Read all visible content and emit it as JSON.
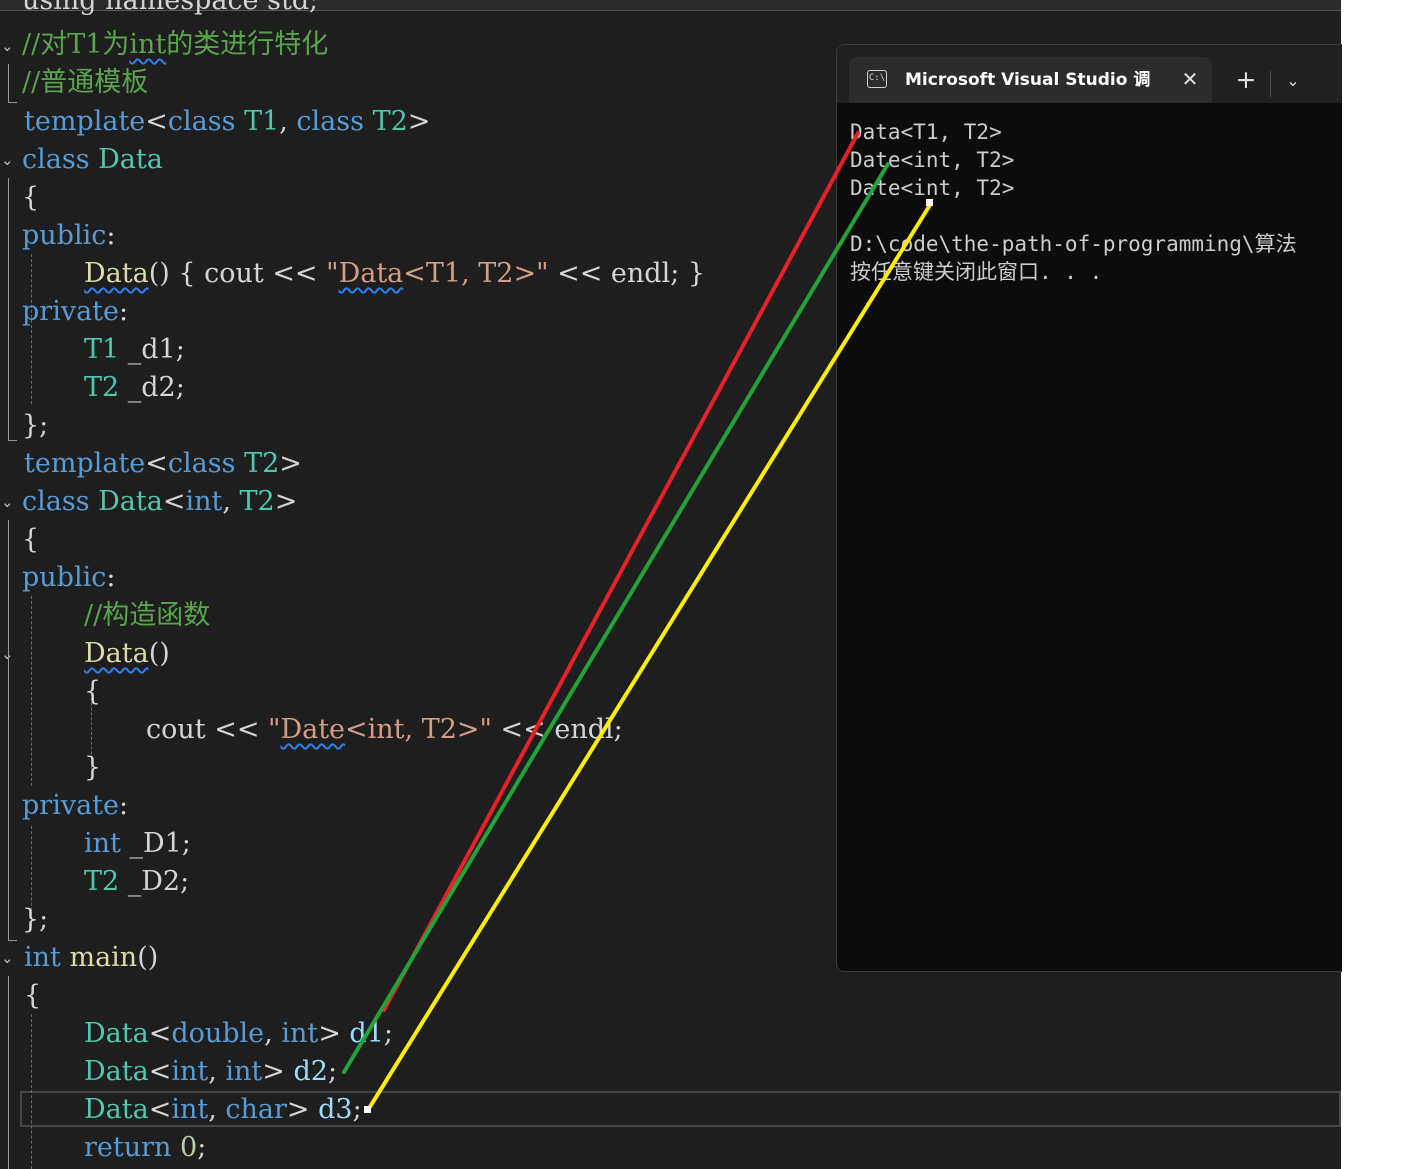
{
  "editor": {
    "lines": [
      {
        "id": "l0",
        "tokens": [
          [
            "pl",
            "using namespace std;"
          ]
        ]
      },
      {
        "id": "l1",
        "tokens": [
          [
            "cm",
            "//对T1为"
          ],
          [
            "cm squig",
            "int"
          ],
          [
            "cm",
            "的类进行特化"
          ]
        ]
      },
      {
        "id": "l2",
        "tokens": [
          [
            "cm",
            "//普通模板"
          ]
        ]
      },
      {
        "id": "l3",
        "tokens": [
          [
            "kw",
            "template"
          ],
          [
            "pl",
            "<"
          ],
          [
            "kw",
            "class "
          ],
          [
            "ty",
            "T1"
          ],
          [
            "pl",
            ", "
          ],
          [
            "kw",
            "class "
          ],
          [
            "ty",
            "T2"
          ],
          [
            "pl",
            ">"
          ]
        ]
      },
      {
        "id": "l4",
        "tokens": [
          [
            "kw",
            "class "
          ],
          [
            "ty",
            "Data"
          ]
        ]
      },
      {
        "id": "l5",
        "tokens": [
          [
            "pl",
            "{"
          ]
        ]
      },
      {
        "id": "l6",
        "tokens": [
          [
            "kw",
            "public"
          ],
          [
            "pl",
            ":"
          ]
        ]
      },
      {
        "id": "l7",
        "tokens": [
          [
            "fn squig",
            "Data"
          ],
          [
            "pl",
            "() { cout << "
          ],
          [
            "st",
            "\""
          ],
          [
            "st squig",
            "Data"
          ],
          [
            "st",
            "<T1, T2>\""
          ],
          [
            "pl",
            " << endl; }"
          ]
        ]
      },
      {
        "id": "l8",
        "tokens": [
          [
            "kw",
            "private"
          ],
          [
            "pl",
            ":"
          ]
        ]
      },
      {
        "id": "l9",
        "tokens": [
          [
            "ty",
            "T1"
          ],
          [
            "pl",
            " _d1;"
          ]
        ]
      },
      {
        "id": "l10",
        "tokens": [
          [
            "ty",
            "T2"
          ],
          [
            "pl",
            " _d2;"
          ]
        ]
      },
      {
        "id": "l11",
        "tokens": [
          [
            "pl",
            "};"
          ]
        ]
      },
      {
        "id": "l12",
        "tokens": [
          [
            "kw",
            "template"
          ],
          [
            "pl",
            "<"
          ],
          [
            "kw",
            "class "
          ],
          [
            "ty",
            "T2"
          ],
          [
            "pl",
            ">"
          ]
        ]
      },
      {
        "id": "l13",
        "tokens": [
          [
            "kw",
            "class "
          ],
          [
            "ty",
            "Data"
          ],
          [
            "pl",
            "<"
          ],
          [
            "kw",
            "int"
          ],
          [
            "pl",
            ", "
          ],
          [
            "ty",
            "T2"
          ],
          [
            "pl",
            ">"
          ]
        ]
      },
      {
        "id": "l14",
        "tokens": [
          [
            "pl",
            "{"
          ]
        ]
      },
      {
        "id": "l15",
        "tokens": [
          [
            "kw",
            "public"
          ],
          [
            "pl",
            ":"
          ]
        ]
      },
      {
        "id": "l16",
        "tokens": [
          [
            "cm",
            "//构造函数"
          ]
        ]
      },
      {
        "id": "l17",
        "tokens": [
          [
            "fn squig",
            "Data"
          ],
          [
            "pl",
            "()"
          ]
        ]
      },
      {
        "id": "l18",
        "tokens": [
          [
            "pl",
            "{"
          ]
        ]
      },
      {
        "id": "l19",
        "tokens": [
          [
            "pl",
            "cout << "
          ],
          [
            "st",
            "\""
          ],
          [
            "st squig",
            "Date"
          ],
          [
            "st",
            "<int, T2>\""
          ],
          [
            "pl",
            " << endl;"
          ]
        ]
      },
      {
        "id": "l20",
        "tokens": [
          [
            "pl",
            "}"
          ]
        ]
      },
      {
        "id": "l21",
        "tokens": [
          [
            "kw",
            "private"
          ],
          [
            "pl",
            ":"
          ]
        ]
      },
      {
        "id": "l22",
        "tokens": [
          [
            "kw",
            "int"
          ],
          [
            "pl",
            " _D1;"
          ]
        ]
      },
      {
        "id": "l23",
        "tokens": [
          [
            "ty",
            "T2"
          ],
          [
            "pl",
            " _D2;"
          ]
        ]
      },
      {
        "id": "l24",
        "tokens": [
          [
            "pl",
            "};"
          ]
        ]
      },
      {
        "id": "l25",
        "tokens": [
          [
            "kw",
            "int "
          ],
          [
            "fn",
            "main"
          ],
          [
            "pl",
            "()"
          ]
        ]
      },
      {
        "id": "l26",
        "tokens": [
          [
            "pl",
            "{"
          ]
        ]
      },
      {
        "id": "l27",
        "tokens": [
          [
            "ty",
            "Data"
          ],
          [
            "pl",
            "<"
          ],
          [
            "kw",
            "double"
          ],
          [
            "pl",
            ", "
          ],
          [
            "kw",
            "int"
          ],
          [
            "pl",
            "> "
          ],
          [
            "var",
            "d1"
          ],
          [
            "pl",
            ";"
          ]
        ]
      },
      {
        "id": "l28",
        "tokens": [
          [
            "ty",
            "Data"
          ],
          [
            "pl",
            "<"
          ],
          [
            "kw",
            "int"
          ],
          [
            "pl",
            ", "
          ],
          [
            "kw",
            "int"
          ],
          [
            "pl",
            "> "
          ],
          [
            "var",
            "d2"
          ],
          [
            "pl",
            ";"
          ]
        ]
      },
      {
        "id": "l29",
        "tokens": [
          [
            "ty",
            "Data"
          ],
          [
            "pl",
            "<"
          ],
          [
            "kw",
            "int"
          ],
          [
            "pl",
            ", "
          ],
          [
            "kw",
            "char"
          ],
          [
            "pl",
            "> "
          ],
          [
            "var",
            "d3"
          ],
          [
            "pl",
            ";"
          ]
        ]
      },
      {
        "id": "l30",
        "tokens": [
          [
            "kw",
            "return "
          ],
          [
            "num",
            "0"
          ],
          [
            "pl",
            ";"
          ]
        ]
      }
    ]
  },
  "terminal": {
    "tab_title": "Microsoft Visual Studio 调试控制台",
    "tab_icon_text": "C:\\",
    "close_glyph": "✕",
    "new_tab_glyph": "+",
    "dropdown_glyph": "⌄",
    "output": [
      "Data<T1, T2>",
      "Date<int, T2>",
      "Date<int, T2>",
      "",
      "D:\\code\\the-path-of-programming\\算法",
      "按任意键关闭此窗口. . ."
    ]
  },
  "annotations": {
    "colors": {
      "red": "#e8202a",
      "green": "#22a33a",
      "yellow": "#ffee00"
    }
  }
}
